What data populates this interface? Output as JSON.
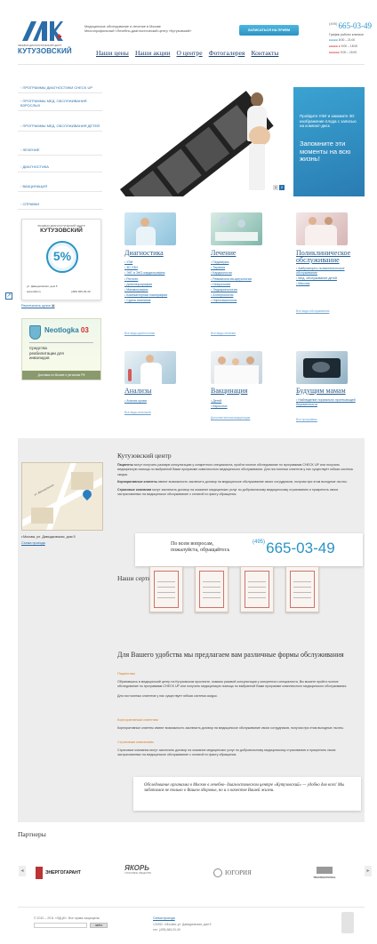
{
  "header": {
    "logo_letters": "ЛДК",
    "logo_small": "ЛЕЧЕБНО-ДИАГНОСТИЧЕСКИЙ ЦЕНТР",
    "logo_name": "КУТУЗОВСКИЙ",
    "tagline1": "Медицинское обследование и лечение в Москве",
    "tagline2": "Многопрофильный «Лечебно-диагностический центр «Кутузовский»",
    "signup_button": "ЗАПИСАТЬСЯ НА ПРИЕМ",
    "phone_code": "(495)",
    "phone": "665-03-49",
    "hours_title": "График работы клиники",
    "hours": [
      {
        "days": "●●●●● ",
        "time": "8:00 – 21:00"
      },
      {
        "days": "●●●●● ● ",
        "time": "9:00 – 18:00"
      },
      {
        "days": "●●●●●● ",
        "time": "9:00 – 15:00"
      }
    ],
    "nav": [
      "Наши цены",
      "Наши акции",
      "О центре",
      "Фотогалерея",
      "Контакты"
    ]
  },
  "sidebar": {
    "items": [
      "ПРОГРАММЫ ДИАГНОСТИКИ CHECK UP",
      "ПРОГРАММЫ МЕД. ОБСЛУЖИВАНИЯ ВЗРОСЛЫХ",
      "ПРОГРАММЫ МЕД. ОБСЛУЖИВАНИЯ ДЕТЕЙ",
      "ЛЕЧЕНИЕ",
      "ДИАГНОСТИКА",
      "ВАКЦИНАЦИЯ",
      "СПРАВКИ"
    ],
    "card_small": "ЛЕЧЕБНО-ДИАГНОСТИЧЕСКИЙ ЦЕНТР",
    "card_name": "КУТУЗОВСКИЙ",
    "card_percent": "5%",
    "card_address": "ул. Давыдковская, дом 5",
    "card_site": "www.ldck.ru",
    "card_phone": "(495) 665-03-49",
    "print_coupon": "Распечатать купон",
    "ad_brand": "Neotlogka",
    "ad_number": "03",
    "ad_line1": "Средства",
    "ad_line2": "реабилитации для",
    "ad_line3": "инвалидов",
    "ad_footer": "Доставка по Москве и регионам РФ"
  },
  "banner": {
    "text1": "Пройдите УЗИ и закажите 3D изображение плода с записью на компакт-диск",
    "text2": "Запомните эти моменты на всю жизнь!",
    "pages": [
      "1",
      "2"
    ]
  },
  "services": [
    {
      "title": "Диагностика",
      "items": [
        "УЗИ",
        "3D УЗИ",
        "ЭКГ и ЭКО-кардиография",
        "Рентген",
        "Допплерография",
        "Маммография",
        "Компьютерная томография",
        "Сдача анализов"
      ],
      "all": "Все виды диагностики"
    },
    {
      "title": "Лечение",
      "items": [
        "Педиатрия",
        "Терапия",
        "Кардиология",
        "Ревматология-артрология",
        "Неврология",
        "Эндокринология",
        "Аллергология",
        "Офтальмология"
      ],
      "all": "Все виды лечения"
    },
    {
      "title": "Поликлиническое обслуживание",
      "items": [
        "Амбулаторно-поликлиническое обслуживание",
        "Мед. обслуживание детей",
        "Массаж"
      ],
      "all": "Все виды обслуживания"
    },
    {
      "title": "Анализы",
      "items": [
        "Анализ крови"
      ],
      "all": "Все виды анализов"
    },
    {
      "title": "Вакцинация",
      "items": [
        "Детей",
        "Взрослых"
      ],
      "all": "Дополнительная вакцинация"
    },
    {
      "title": "Будущим мамам",
      "items": [
        "Наблюдение нормально протекающей беременности"
      ],
      "all": "Все программы"
    }
  ],
  "center": {
    "heading": "Кутузовский центр",
    "p1_bold": "Пациенты",
    "p1": " могут получить разовую консультацию у конкретного специалиста, пройти полное обследование по программам CHECK UP или получить медицинскую помощь по выбранной Вами программе комплексного медицинского обслуживания. Для постоянных клиентов у нас существует гибкая система скидок.",
    "p2_bold": "Корпоративные клиенты",
    "p2": " имеют возможность заключить договор на медицинское обслуживание своих сотрудников, получая при этом выгодные льготы.",
    "p3_bold": "Страховые компании",
    "p3": " могут заключить договор на оказание медицинских услуг по добровольному медицинскому страхованию и прикрепить своих застрахованных на медицинское обслуживание с оплатой по факту обращения.",
    "map_label": "ул. Давыдковская",
    "address": "г.Москва, ул. Давыдковская, дом 5",
    "scheme_link": "Схема проезда",
    "questions1": "По всем вопросам,",
    "questions2": "пожалуйста, обращайтесь",
    "q_phone_code": "(495)",
    "q_phone": "665-03-49",
    "certificates_heading": "Наши сертификаты",
    "forms_heading": "Для Вашего удобства мы предлагаем вам различные формы обслуживания",
    "f1_title": "Пациентам",
    "f1_text": "Обратившись в медицинский центр на Кутузовском проспекте, помимо разовой консультации у конкретного специалиста, Вы можете пройти полное обследование по программам CHECK UP или получить медицинскую помощь по выбранной Вами программе комплексного медицинского обслуживания.",
    "f1_text2": "Для постоянных клиентов у нас существует гибкая система скидок.",
    "f2_title": "Корпоративным клиентам",
    "f2_text": "Корпоративные клиенты имеют возможность заключить договор на медицинское обслуживание своих сотрудников, получая при этом выгодные льготы.",
    "f3_title": "Страховым компаниям",
    "f3_text": "Страховые компании могут заключить договор на оказание медицинских услуг по добровольному медицинскому страхованию и прикрепить своих застрахованных на медицинское обслуживание с оплатой по факту обращения.",
    "quote": "Обследование организма в Москве в лечебно- диагностическом центре «Кутузовский» — удобно для всех! Мы заботимся не только о Вашем здоровье, но и о качестве Вашей жизни."
  },
  "partners": {
    "heading": "Партнеры",
    "list": [
      "ЭНЕРГОГАРАНТ",
      "ЯКОРЬ",
      "ЮГОРИЯ",
      "TRANSNATIONAL"
    ],
    "yakor_sub": "СТРАХОВОЕ ОБЩЕСТВО"
  },
  "footer": {
    "copyright": "© 2010 – 2011 «ЛДЦК». Все права защищены",
    "search_button": "найти",
    "scheme": "Схема проезда",
    "address": "121552, г.Москва, ул. Давыдковская, дом 5",
    "phone": "тел. (495) 665-03-49"
  },
  "colors": {
    "accent": "#2f9fd0",
    "link": "#2a6fa8",
    "brand_red": "#d22c2c",
    "banner_blue": "#2b8fc4"
  }
}
